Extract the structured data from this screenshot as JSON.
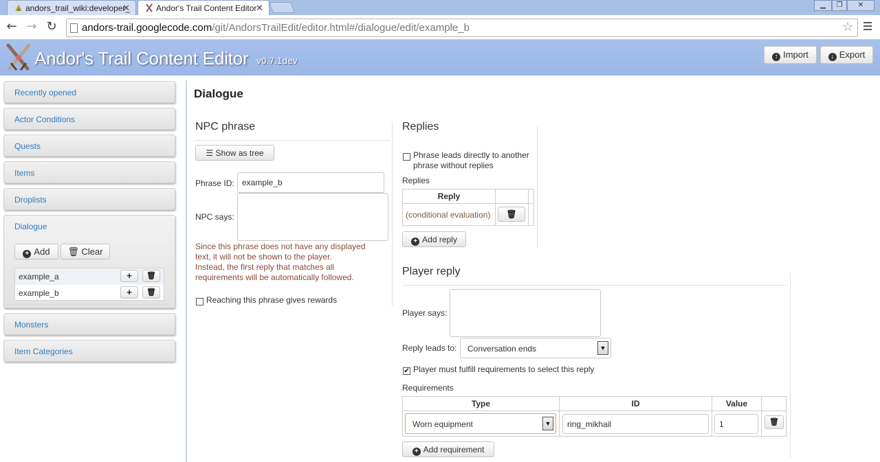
{
  "browser": {
    "tabs": [
      {
        "title": "andors_trail_wiki:developer_",
        "close": "✕"
      },
      {
        "title": "Andor's Trail Content Editor",
        "close": "✕"
      }
    ],
    "url_host": "andors-trail.googlecode.com",
    "url_path": "/git/AndorsTrailEdit/editor.html#/dialogue/edit/example_b"
  },
  "app": {
    "title": "Andor's Trail Content Editor",
    "version": "v0.7.1dev",
    "import_label": "Import",
    "export_label": "Export"
  },
  "sidebar": {
    "items": [
      {
        "label": "Recently opened"
      },
      {
        "label": "Actor Conditions"
      },
      {
        "label": "Quests"
      },
      {
        "label": "Items"
      },
      {
        "label": "Droplists"
      },
      {
        "label": "Dialogue"
      },
      {
        "label": "Monsters"
      },
      {
        "label": "Item Categories"
      }
    ],
    "add_label": "Add",
    "clear_label": "Clear",
    "dialogue_entries": [
      "example_a",
      "example_b"
    ]
  },
  "main": {
    "heading": "Dialogue",
    "npc": {
      "section_title": "NPC phrase",
      "show_tree_label": "Show as tree",
      "phrase_id_label": "Phrase ID:",
      "phrase_id_value": "example_b",
      "npc_says_label": "NPC says:",
      "npc_says_value": "",
      "hint_lines": [
        "Since this phrase does not have any displayed",
        "text, it will not be shown to the player.",
        "Instead, the first reply that matches all",
        "requirements will be automatically followed."
      ],
      "rewards_label": "Reaching this phrase gives rewards",
      "rewards_checked": false
    },
    "replies": {
      "section_title": "Replies",
      "direct_label_line1": "Phrase leads directly to another",
      "direct_label_line2": "phrase without replies",
      "direct_checked": false,
      "list_label": "Replies",
      "col_reply": "Reply",
      "rows": [
        {
          "text": "(conditional evaluation)"
        }
      ],
      "add_reply_label": "Add reply"
    },
    "player_reply": {
      "section_title": "Player reply",
      "says_label": "Player says:",
      "says_value": "",
      "leads_to_label": "Reply leads to:",
      "leads_to_value": "Conversation ends",
      "must_fulfill_label": "Player must fulfill requirements to select this reply",
      "must_fulfill_checked": true,
      "requirements_label": "Requirements",
      "columns": [
        "Type",
        "ID",
        "Value"
      ],
      "rows": [
        {
          "type": "Worn equipment",
          "id": "ring_mikhail",
          "value": "1"
        }
      ],
      "add_requirement_label": "Add requirement"
    }
  },
  "colors": {
    "header_bg": "#9ab7e8",
    "link": "#2f7dc1",
    "hint": "#8b4a36"
  }
}
